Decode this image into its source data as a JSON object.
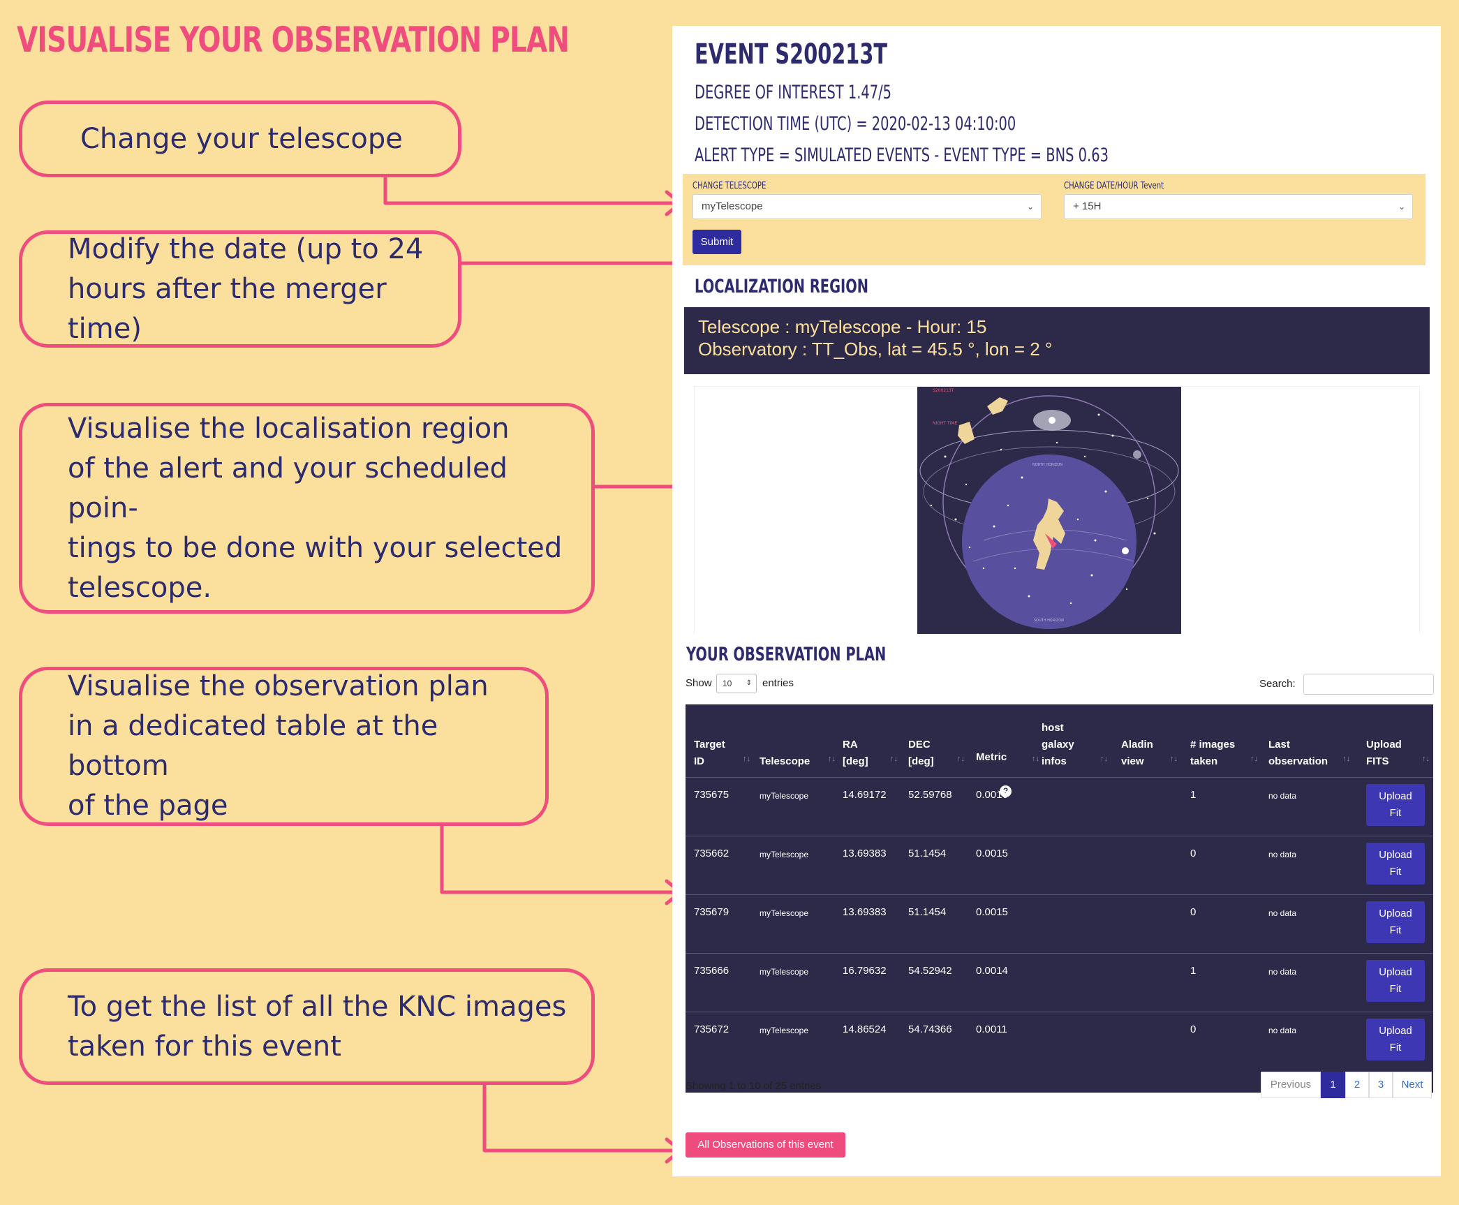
{
  "page_title": "VISUALISE YOUR OBSERVATION PLAN",
  "callouts": {
    "telescope": "Change your telescope",
    "date": "Modify the date (up to 24\nhours after the merger time)",
    "localisation": "Visualise the localisation region\nof the alert and your scheduled poin-\ntings to be done with your selected\ntelescope.",
    "table": "Visualise the observation plan\nin a dedicated table at the bottom\nof the page",
    "knc": "To get the list of all the KNC images\ntaken for this event"
  },
  "event": {
    "title": "EVENT S200213T",
    "degree": "DEGREE OF INTEREST 1.47/5",
    "detection_time": "DETECTION TIME (UTC) = 2020-02-13 04:10:00",
    "alert_type": "ALERT TYPE = SIMULATED EVENTS - EVENT TYPE = BNS 0.63"
  },
  "form": {
    "telescope_label": "CHANGE TELESCOPE",
    "telescope_value": "myTelescope",
    "date_label": "CHANGE DATE/HOUR Tevent",
    "date_value": "+ 15H",
    "submit_label": "Submit"
  },
  "localization": {
    "title": "LOCALIZATION REGION",
    "line1": "Telescope : myTelescope - Hour: 15",
    "line2": "Observatory : TT_Obs, lat = 45.5 °, lon = 2 °"
  },
  "plan": {
    "title": "YOUR OBSERVATION PLAN",
    "show_label": "Show",
    "show_value": "10",
    "entries_label": "entries",
    "search_label": "Search:",
    "headers": {
      "target_id": "Target\nID",
      "telescope": "Telescope",
      "ra": "RA\n[deg]",
      "dec": "DEC\n[deg]",
      "metric": "Metric",
      "host": "host\ngalaxy\ninfos",
      "aladin": "Aladin\nview",
      "images": "# images\ntaken",
      "last": "Last\nobservation",
      "upload": "Upload\nFITS"
    },
    "rows": [
      {
        "id": "735675",
        "telescope": "myTelescope",
        "ra": "14.69172",
        "dec": "52.59768",
        "metric": "0.0016",
        "images": "1",
        "last": "no data",
        "upload": "Upload\nFit"
      },
      {
        "id": "735662",
        "telescope": "myTelescope",
        "ra": "13.69383",
        "dec": "51.1454",
        "metric": "0.0015",
        "images": "0",
        "last": "no data",
        "upload": "Upload\nFit"
      },
      {
        "id": "735679",
        "telescope": "myTelescope",
        "ra": "13.69383",
        "dec": "51.1454",
        "metric": "0.0015",
        "images": "0",
        "last": "no data",
        "upload": "Upload\nFit"
      },
      {
        "id": "735666",
        "telescope": "myTelescope",
        "ra": "16.79632",
        "dec": "54.52942",
        "metric": "0.0014",
        "images": "1",
        "last": "no data",
        "upload": "Upload\nFit"
      },
      {
        "id": "735672",
        "telescope": "myTelescope",
        "ra": "14.86524",
        "dec": "54.74366",
        "metric": "0.0011",
        "images": "0",
        "last": "no data",
        "upload": "Upload\nFit"
      }
    ],
    "info": "Showing 1 to 10 of 25 entries",
    "pagination": {
      "previous": "Previous",
      "p1": "1",
      "p2": "2",
      "p3": "3",
      "next": "Next"
    },
    "all_obs_label": "All Observations of this event"
  },
  "skymap": {
    "north_horizon": "NORTH HORIZON",
    "south_horizon": "SOUTH HORIZON",
    "night_time": "NIGHT TIME",
    "event_label": "S200213T"
  },
  "colors": {
    "background": "#fbe09d",
    "accent": "#ef4d7e",
    "navy": "#2c2949",
    "button": "#2d2b9e"
  }
}
